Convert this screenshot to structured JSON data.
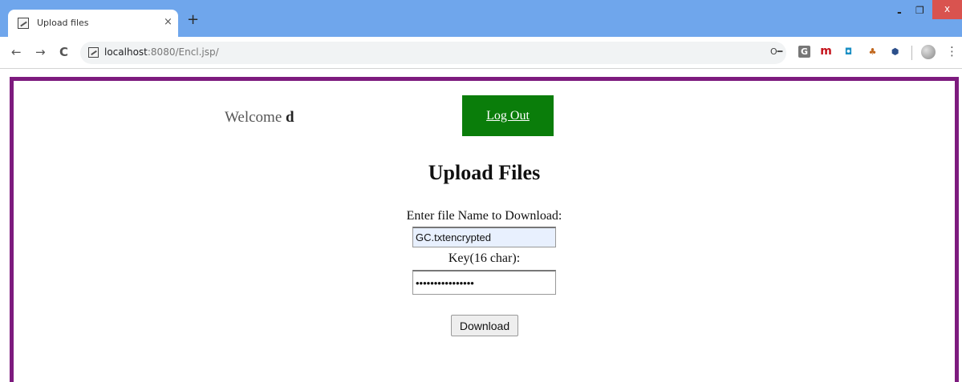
{
  "browser": {
    "tab_title": "Upload files",
    "tab_close": "×",
    "new_tab": "+",
    "window_controls": {
      "minimize": "-",
      "maximize": "❐",
      "close": "x"
    },
    "nav": {
      "back": "←",
      "forward": "→",
      "reload": "C"
    },
    "address": {
      "host": "localhost",
      "rest": ":8080/Encl.jsp/"
    },
    "key_icon_glyph": "O━",
    "extensions": [
      {
        "name": "G-extension-icon",
        "glyph": "G"
      },
      {
        "name": "m-extension-icon",
        "glyph": "m"
      },
      {
        "name": "cube-extension-icon",
        "glyph": "◘"
      },
      {
        "name": "leaf-extension-icon",
        "glyph": "♣"
      },
      {
        "name": "shield-extension-icon",
        "glyph": "⬢"
      }
    ],
    "menu_glyph": "⋮"
  },
  "page": {
    "welcome_text": "Welcome",
    "username": "d",
    "logout_label": "Log Out",
    "title": "Upload Files",
    "filename_label": "Enter file Name to Download:",
    "filename_value": "GC.txtencrypted",
    "key_label": "Key(16 char):",
    "key_value": "••••••••••••••••",
    "download_label": "Download"
  },
  "colors": {
    "tabstrip": "#6fa6ec",
    "frame_border": "#7d1b7e",
    "logout_bg": "#0a7d0a"
  }
}
